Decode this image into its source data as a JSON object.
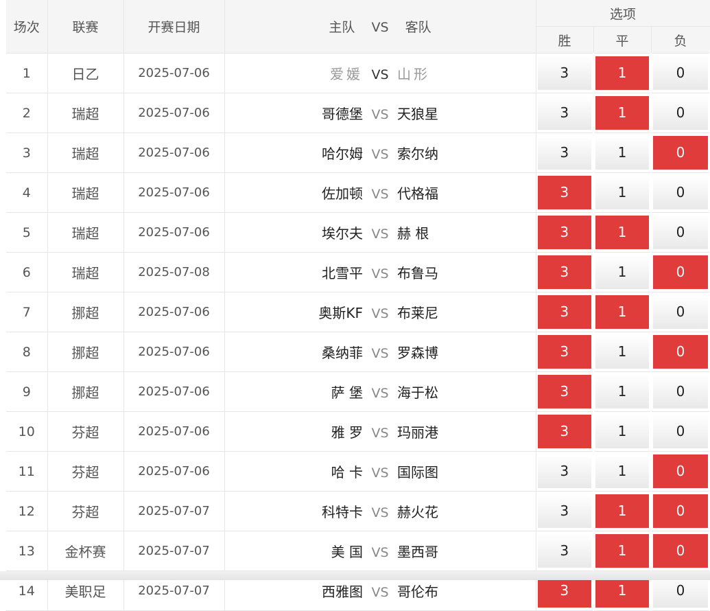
{
  "header": {
    "idx": "场次",
    "league": "联赛",
    "date": "开赛日期",
    "home": "主队",
    "vs": "VS",
    "away": "客队",
    "options": "选项",
    "win": "胜",
    "draw": "平",
    "lose": "负"
  },
  "colors": {
    "selected": "#e03c3c",
    "header_bg": "#f5f5f5"
  },
  "rows": [
    {
      "idx": "1",
      "league": "日乙",
      "date": "2025-07-06",
      "home": "爱媛",
      "vs": "VS",
      "away": "山形",
      "w": "3",
      "d": "1",
      "l": "0",
      "sel": [
        false,
        true,
        false
      ]
    },
    {
      "idx": "2",
      "league": "瑞超",
      "date": "2025-07-06",
      "home": "哥德堡",
      "vs": "VS",
      "away": "天狼星",
      "w": "3",
      "d": "1",
      "l": "0",
      "sel": [
        false,
        true,
        false
      ]
    },
    {
      "idx": "3",
      "league": "瑞超",
      "date": "2025-07-06",
      "home": "哈尔姆",
      "vs": "VS",
      "away": "索尔纳",
      "w": "3",
      "d": "1",
      "l": "0",
      "sel": [
        false,
        false,
        true
      ]
    },
    {
      "idx": "4",
      "league": "瑞超",
      "date": "2025-07-06",
      "home": "佐加顿",
      "vs": "VS",
      "away": "代格福",
      "w": "3",
      "d": "1",
      "l": "0",
      "sel": [
        true,
        false,
        false
      ]
    },
    {
      "idx": "5",
      "league": "瑞超",
      "date": "2025-07-06",
      "home": "埃尔夫",
      "vs": "VS",
      "away": "赫 根",
      "w": "3",
      "d": "1",
      "l": "0",
      "sel": [
        true,
        true,
        false
      ]
    },
    {
      "idx": "6",
      "league": "瑞超",
      "date": "2025-07-08",
      "home": "北雪平",
      "vs": "VS",
      "away": "布鲁马",
      "w": "3",
      "d": "1",
      "l": "0",
      "sel": [
        true,
        false,
        true
      ]
    },
    {
      "idx": "7",
      "league": "挪超",
      "date": "2025-07-06",
      "home": "奥斯KF",
      "vs": "VS",
      "away": "布莱尼",
      "w": "3",
      "d": "1",
      "l": "0",
      "sel": [
        true,
        true,
        false
      ]
    },
    {
      "idx": "8",
      "league": "挪超",
      "date": "2025-07-06",
      "home": "桑纳菲",
      "vs": "VS",
      "away": "罗森博",
      "w": "3",
      "d": "1",
      "l": "0",
      "sel": [
        true,
        false,
        true
      ]
    },
    {
      "idx": "9",
      "league": "挪超",
      "date": "2025-07-06",
      "home": "萨 堡",
      "vs": "VS",
      "away": "海于松",
      "w": "3",
      "d": "1",
      "l": "0",
      "sel": [
        true,
        false,
        false
      ]
    },
    {
      "idx": "10",
      "league": "芬超",
      "date": "2025-07-06",
      "home": "雅 罗",
      "vs": "VS",
      "away": "玛丽港",
      "w": "3",
      "d": "1",
      "l": "0",
      "sel": [
        true,
        false,
        false
      ]
    },
    {
      "idx": "11",
      "league": "芬超",
      "date": "2025-07-06",
      "home": "哈 卡",
      "vs": "VS",
      "away": "国际图",
      "w": "3",
      "d": "1",
      "l": "0",
      "sel": [
        false,
        false,
        true
      ]
    },
    {
      "idx": "12",
      "league": "芬超",
      "date": "2025-07-07",
      "home": "科特卡",
      "vs": "VS",
      "away": "赫火花",
      "w": "3",
      "d": "1",
      "l": "0",
      "sel": [
        false,
        true,
        true
      ]
    },
    {
      "idx": "13",
      "league": "金杯赛",
      "date": "2025-07-07",
      "home": "美 国",
      "vs": "VS",
      "away": "墨西哥",
      "w": "3",
      "d": "1",
      "l": "0",
      "sel": [
        false,
        true,
        true
      ]
    },
    {
      "idx": "14",
      "league": "美职足",
      "date": "2025-07-07",
      "home": "西雅图",
      "vs": "VS",
      "away": "哥伦布",
      "w": "3",
      "d": "1",
      "l": "0",
      "sel": [
        true,
        true,
        false
      ]
    }
  ]
}
